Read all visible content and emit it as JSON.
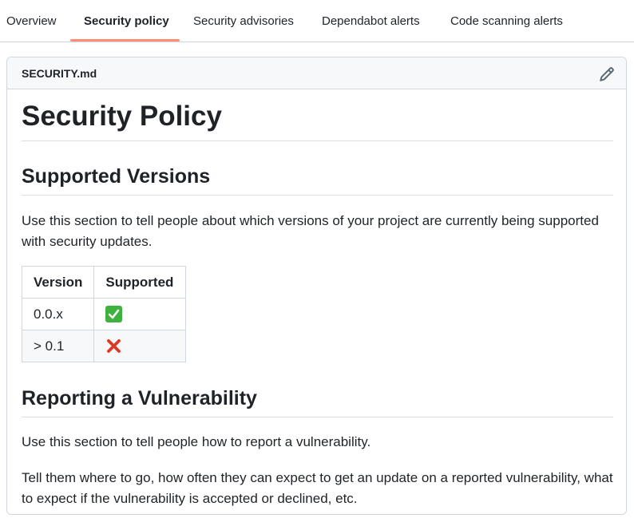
{
  "tabs": [
    {
      "label": "Overview"
    },
    {
      "label": "Security policy"
    },
    {
      "label": "Security advisories"
    },
    {
      "label": "Dependabot alerts"
    },
    {
      "label": "Code scanning alerts"
    }
  ],
  "active_tab": "Security policy",
  "file": {
    "name": "SECURITY.md"
  },
  "doc": {
    "title": "Security Policy",
    "supported_heading": "Supported Versions",
    "supported_text": "Use this section to tell people about which versions of your project are currently being supported with security updates.",
    "table": {
      "headers": [
        "Version",
        "Supported"
      ],
      "rows": [
        {
          "version": "0.0.x",
          "supported": "check-icon"
        },
        {
          "version": "> 0.1",
          "supported": "cross-icon"
        }
      ]
    },
    "reporting_heading": "Reporting a Vulnerability",
    "reporting_text_1": "Use this section to tell people how to report a vulnerability.",
    "reporting_text_2": "Tell them where to go, how often they can expect to get an update on a reported vulnerability, what to expect if the vulnerability is accepted or declined, etc."
  },
  "colors": {
    "active_tab_underline": "#fd8c73",
    "check_green": "#3fb13f",
    "cross_red": "#e0412e"
  }
}
